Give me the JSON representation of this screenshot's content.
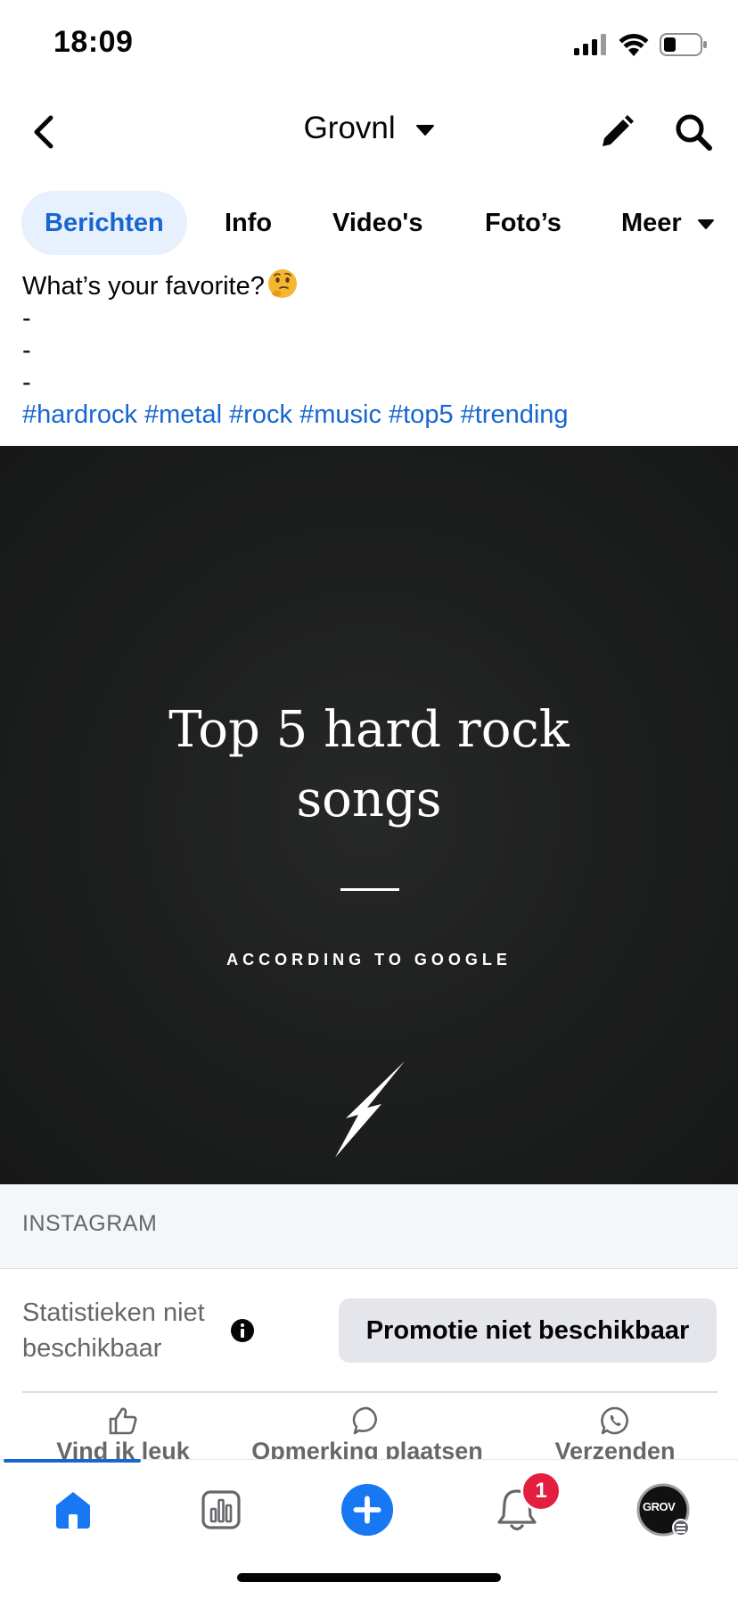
{
  "status_bar": {
    "time": "18:09"
  },
  "header": {
    "title": "Grovnl"
  },
  "tabs": [
    {
      "label": "Berichten",
      "active": true
    },
    {
      "label": "Info"
    },
    {
      "label": "Video's"
    },
    {
      "label": "Foto’s"
    },
    {
      "label": "Meer"
    }
  ],
  "post": {
    "text_line": "What’s your favorite?",
    "emoji": "thinking-face-icon",
    "dash_lines": [
      "-",
      "-",
      "-"
    ],
    "hashtags": "#hardrock #metal #rock #music #top5 #trending",
    "image": {
      "title_line1": "Top 5 hard rock",
      "title_line2": "songs",
      "subtitle": "ACCORDING TO GOOGLE",
      "icon": "lightning-bolt-icon"
    },
    "source_label": "INSTAGRAM",
    "stats_text": "Statistieken niet beschikbaar",
    "promote_label": "Promotie niet beschikbaar",
    "actions": {
      "like": "Vind ik leuk",
      "comment": "Opmerking plaatsen",
      "send": "Verzenden"
    }
  },
  "tabbar": {
    "notifications_badge": "1",
    "profile_initials": "GROV"
  },
  "colors": {
    "accent": "#1766cf",
    "create_button": "#1877f2",
    "badge": "#e41e3f",
    "image_bg": "#1e1f1f"
  }
}
